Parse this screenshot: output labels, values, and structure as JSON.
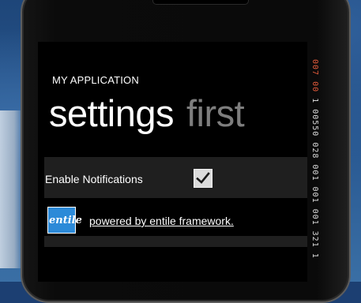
{
  "app": {
    "title": "MY APPLICATION",
    "pivot_active": "settings",
    "pivot_inactive": "first"
  },
  "settings": {
    "enable_notifications_label": "Enable Notifications",
    "enable_notifications_checked": true
  },
  "footer": {
    "logo_text": "entile",
    "link_text": "powered by entile framework."
  },
  "debug_counters": {
    "red_part": "007 00",
    "white_part": "1 00550 028 001 001 001 321 1"
  },
  "colors": {
    "accent": "#2c8ad8",
    "background": "#000000",
    "row": "#1f1f1f",
    "inactive_pivot": "#7e7e7e"
  }
}
